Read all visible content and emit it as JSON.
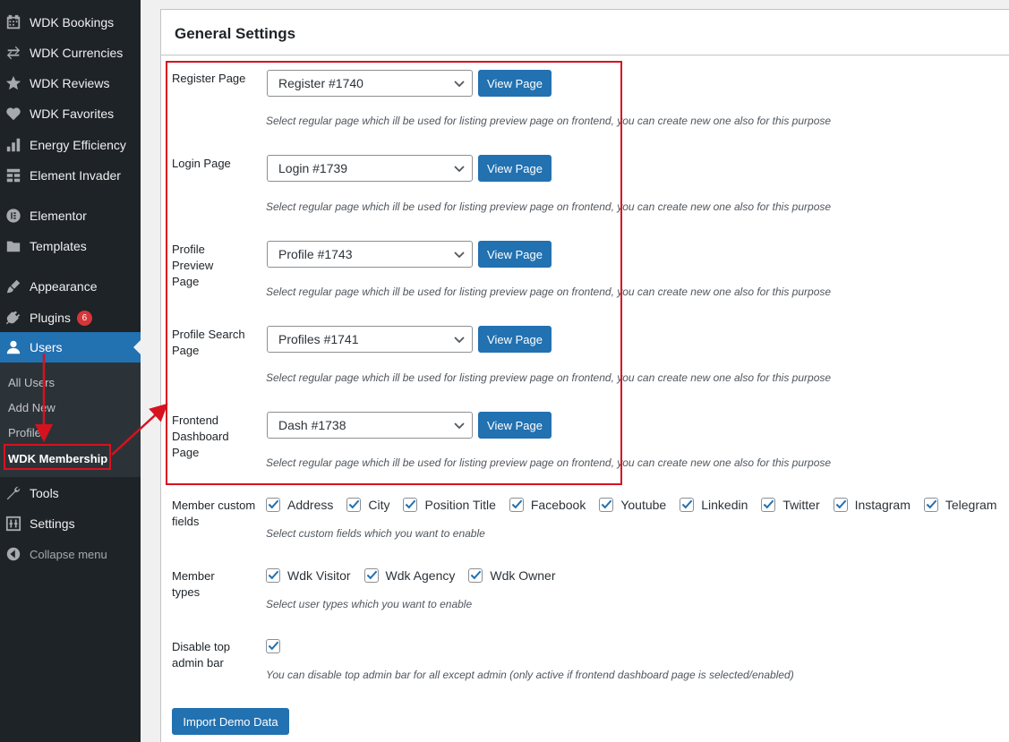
{
  "sidebar": {
    "items": [
      {
        "label": "WDK Bookings",
        "icon": "calendar-icon"
      },
      {
        "label": "WDK Currencies",
        "icon": "arrows-swap-icon"
      },
      {
        "label": "WDK Reviews",
        "icon": "star-icon"
      },
      {
        "label": "WDK Favorites",
        "icon": "heart-icon"
      },
      {
        "label": "Energy Efficiency",
        "icon": "bar-chart-icon"
      },
      {
        "label": "Element Invader",
        "icon": "grid-icon"
      },
      {
        "label": "Elementor",
        "icon": "elementor-icon"
      },
      {
        "label": "Templates",
        "icon": "folder-icon"
      },
      {
        "label": "Appearance",
        "icon": "brush-icon"
      },
      {
        "label": "Plugins",
        "icon": "plug-icon",
        "badge": "6"
      },
      {
        "label": "Users",
        "icon": "user-icon"
      },
      {
        "label": "Tools",
        "icon": "wrench-icon"
      },
      {
        "label": "Settings",
        "icon": "sliders-icon"
      },
      {
        "label": "Collapse menu",
        "icon": "collapse-arrow-icon"
      }
    ],
    "submenu": [
      "All Users",
      "Add New",
      "Profile",
      "WDK Membership"
    ]
  },
  "panel": {
    "title": "General Settings",
    "page_rows": [
      {
        "label": "Register Page",
        "selected": "Register #1740",
        "button": "View Page",
        "description": "Select regular page which ill be used for listing preview page on frontend, you can create new one also for this purpose"
      },
      {
        "label": "Login Page",
        "selected": "Login #1739",
        "button": "View Page",
        "description": "Select regular page which ill be used for listing preview page on frontend, you can create new one also for this purpose"
      },
      {
        "label": "Profile Preview Page",
        "selected": "Profile #1743",
        "button": "View Page",
        "description": "Select regular page which ill be used for listing preview page on frontend, you can create new one also for this purpose"
      },
      {
        "label": "Profile Search Page",
        "selected": "Profiles #1741",
        "button": "View Page",
        "description": "Select regular page which ill be used for listing preview page on frontend, you can create new one also for this purpose"
      },
      {
        "label": "Frontend Dashboard Page",
        "selected": "Dash #1738",
        "button": "View Page",
        "description": "Select regular page which ill be used for listing preview page on frontend, you can create new one also for this purpose"
      }
    ],
    "custom_fields": {
      "label": "Member custom fields",
      "options": [
        "Address",
        "City",
        "Position Title",
        "Facebook",
        "Youtube",
        "Linkedin",
        "Twitter",
        "Instagram",
        "Telegram"
      ],
      "description": "Select custom fields which you want to enable"
    },
    "member_types": {
      "label": "Member types",
      "options": [
        "Wdk Visitor",
        "Wdk Agency",
        "Wdk Owner"
      ],
      "description": "Select user types which you want to enable"
    },
    "admin_bar": {
      "label": "Disable top admin bar",
      "checked": true,
      "description": "You can disable top admin bar for all except admin (only active if frontend dashboard page is selected/enabled)"
    },
    "import_button": "Import Demo Data"
  },
  "colors": {
    "accent": "#2271b1",
    "annotation": "#d7121f",
    "sidebar": "#1d2327"
  }
}
